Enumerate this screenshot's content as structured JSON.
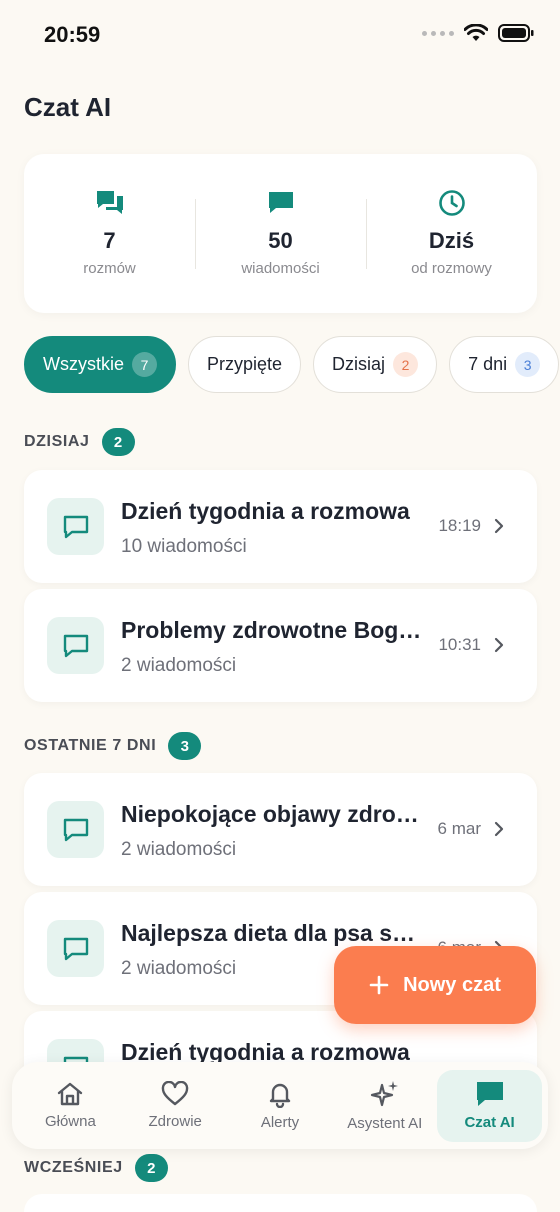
{
  "status": {
    "time": "20:59"
  },
  "page": {
    "title": "Czat AI"
  },
  "stats": [
    {
      "icon": "chat-bubbles-icon",
      "value": "7",
      "label": "rozmów"
    },
    {
      "icon": "message-icon",
      "value": "50",
      "label": "wiadomości"
    },
    {
      "icon": "clock-icon",
      "value": "Dziś",
      "label": "od rozmowy"
    }
  ],
  "filters": [
    {
      "label": "Wszystkie",
      "count": "7",
      "active": true
    },
    {
      "label": "Przypięte",
      "count": ""
    },
    {
      "label": "Dzisiaj",
      "count": "2"
    },
    {
      "label": "7 dni",
      "count": "3"
    }
  ],
  "sections": {
    "today": {
      "title": "DZISIAJ",
      "count": "2"
    },
    "week": {
      "title": "OSTATNIE 7 DNI",
      "count": "3"
    },
    "earlier": {
      "title": "WCZEŚNIEJ",
      "count": "2"
    }
  },
  "chats": [
    {
      "title": "Dzień tygodnia a rozmowa",
      "subtitle": "10 wiadomości",
      "time": "18:19"
    },
    {
      "title": "Problemy zdrowotne Bogusia",
      "subtitle": "2 wiadomości",
      "time": "10:31"
    },
    {
      "title": "Niepokojące objawy zdrowotne",
      "subtitle": "2 wiadomości",
      "time": "6 mar"
    },
    {
      "title": "Najlepsza dieta dla psa seniora",
      "subtitle": "2 wiadomości",
      "time": "6 mar"
    },
    {
      "title": "Dzień tygodnia a rozmowa",
      "subtitle": "",
      "time": ""
    }
  ],
  "fab": {
    "label": "Nowy czat"
  },
  "tabs": [
    {
      "label": "Główna",
      "icon": "home-icon"
    },
    {
      "label": "Zdrowie",
      "icon": "heart-icon"
    },
    {
      "label": "Alerty",
      "icon": "bell-icon"
    },
    {
      "label": "Asystent AI",
      "icon": "sparkles-icon"
    },
    {
      "label": "Czat AI",
      "icon": "chat-icon",
      "active": true
    }
  ],
  "colors": {
    "primary": "#148a7c",
    "accent": "#fb7d4f",
    "background": "#fcf9f3"
  }
}
